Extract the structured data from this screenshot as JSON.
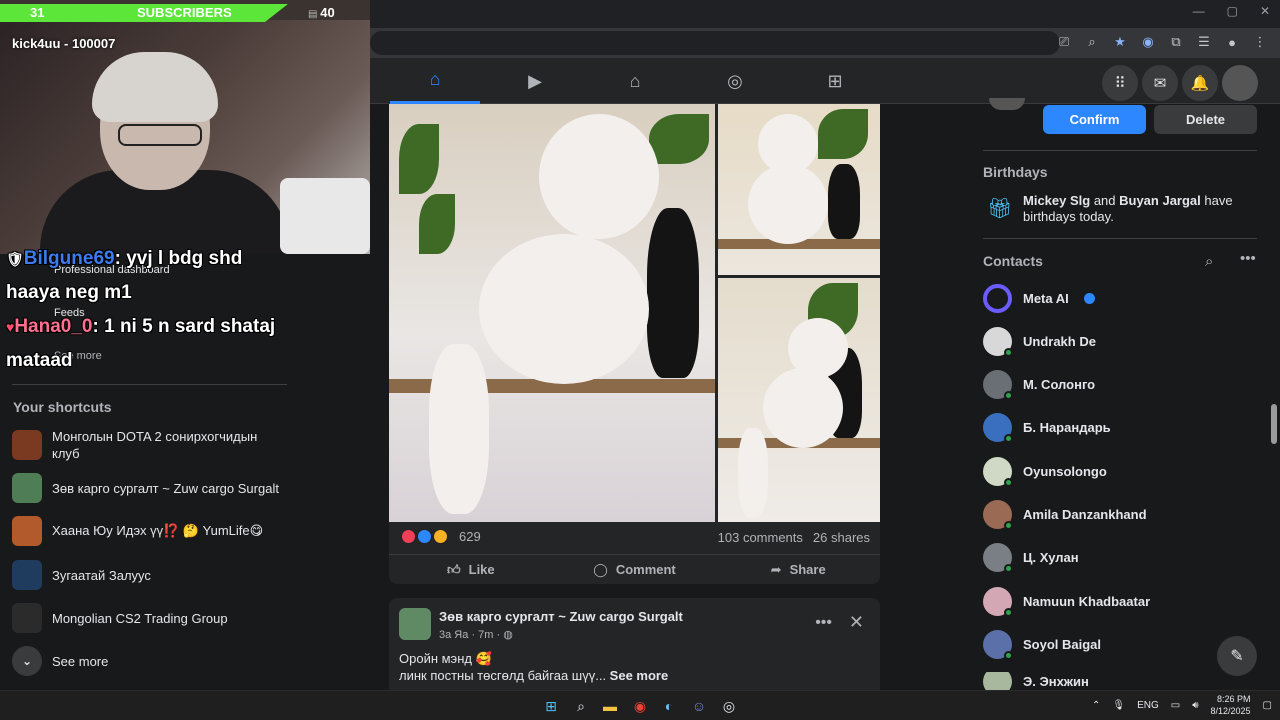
{
  "stream": {
    "sub_count": "31",
    "sub_label": "SUBSCRIBERS",
    "sub_goal": "40",
    "streamer": "kick4uu - 100007"
  },
  "chat": [
    {
      "user": "Bilgune69",
      "sep": ":",
      "msg": "yvj l bdg shd"
    },
    {
      "cont": "haaya neg m1"
    },
    {
      "user": "Hana0_0",
      "sep": ":",
      "msg": "1 ni 5 n sard shataj"
    },
    {
      "cont": "mataad"
    }
  ],
  "left_sidebar": {
    "professional_dashboard": "Professional dashboard",
    "feeds": "Feeds",
    "see_more_partial": "See more",
    "shortcuts_title": "Your shortcuts",
    "shortcuts": [
      {
        "label": "Монголын DOTA 2 сонирхогчидын клуб",
        "color": "#7a3a22"
      },
      {
        "label": "Зөв карго сургалт ~ Zuw cargo Surgalt",
        "color": "#4f7d55"
      },
      {
        "label": "Хаана Юу Идэх үү⁉️ 🤔 YumLife😋",
        "color": "#b35a2c"
      },
      {
        "label": "Зугаатай Залуус",
        "color": "#1f3b5e"
      },
      {
        "label": "Mongolian CS2 Trading Group",
        "color": "#2b2b2b"
      }
    ],
    "see_more": "See more"
  },
  "post": {
    "reaction_count": "629",
    "comments": "103 comments",
    "shares": "26 shares",
    "like": "Like",
    "comment": "Comment",
    "share": "Share"
  },
  "post2": {
    "author": "Зөв карго сургалт ~ Zuw cargo Surgalt",
    "meta": "3а Яа · 7m · ",
    "line1": "Оройн мэнд 🥰",
    "line2": "линк постны төсгөлд байгаа шүү... ",
    "see_more": "See more"
  },
  "right_sidebar": {
    "confirm": "Confirm",
    "delete": "Delete",
    "birthdays_title": "Birthdays",
    "bday_name1": "Mickey Slg",
    "bday_and": " and ",
    "bday_name2": "Buyan Jargal",
    "bday_rest": " have birthdays today.",
    "contacts_title": "Contacts",
    "contacts": [
      {
        "name": "Meta AI",
        "color": "#6a5cff",
        "online": false,
        "verified": true
      },
      {
        "name": "Undrakh De",
        "color": "#d8d8d8",
        "online": true
      },
      {
        "name": "М. Солонго",
        "color": "#6a6e75",
        "online": true
      },
      {
        "name": "Б. Нарандарь",
        "color": "#3a6fbf",
        "online": true
      },
      {
        "name": "Oyunsolongo",
        "color": "#cfd9c5",
        "online": true
      },
      {
        "name": "Amila Danzankhand",
        "color": "#9b6a55",
        "online": true
      },
      {
        "name": "Ц. Хулан",
        "color": "#7a7f85",
        "online": true
      },
      {
        "name": "Namuun Khadbaatar",
        "color": "#d4a7b5",
        "online": true
      },
      {
        "name": "Soyol Baigal",
        "color": "#5b6fa8",
        "online": true
      },
      {
        "name": "Э. Энхжин",
        "color": "#a7b89e",
        "online": true
      }
    ]
  },
  "taskbar": {
    "lang": "ENG",
    "time": "8:26 PM",
    "date": "8/12/2025"
  }
}
